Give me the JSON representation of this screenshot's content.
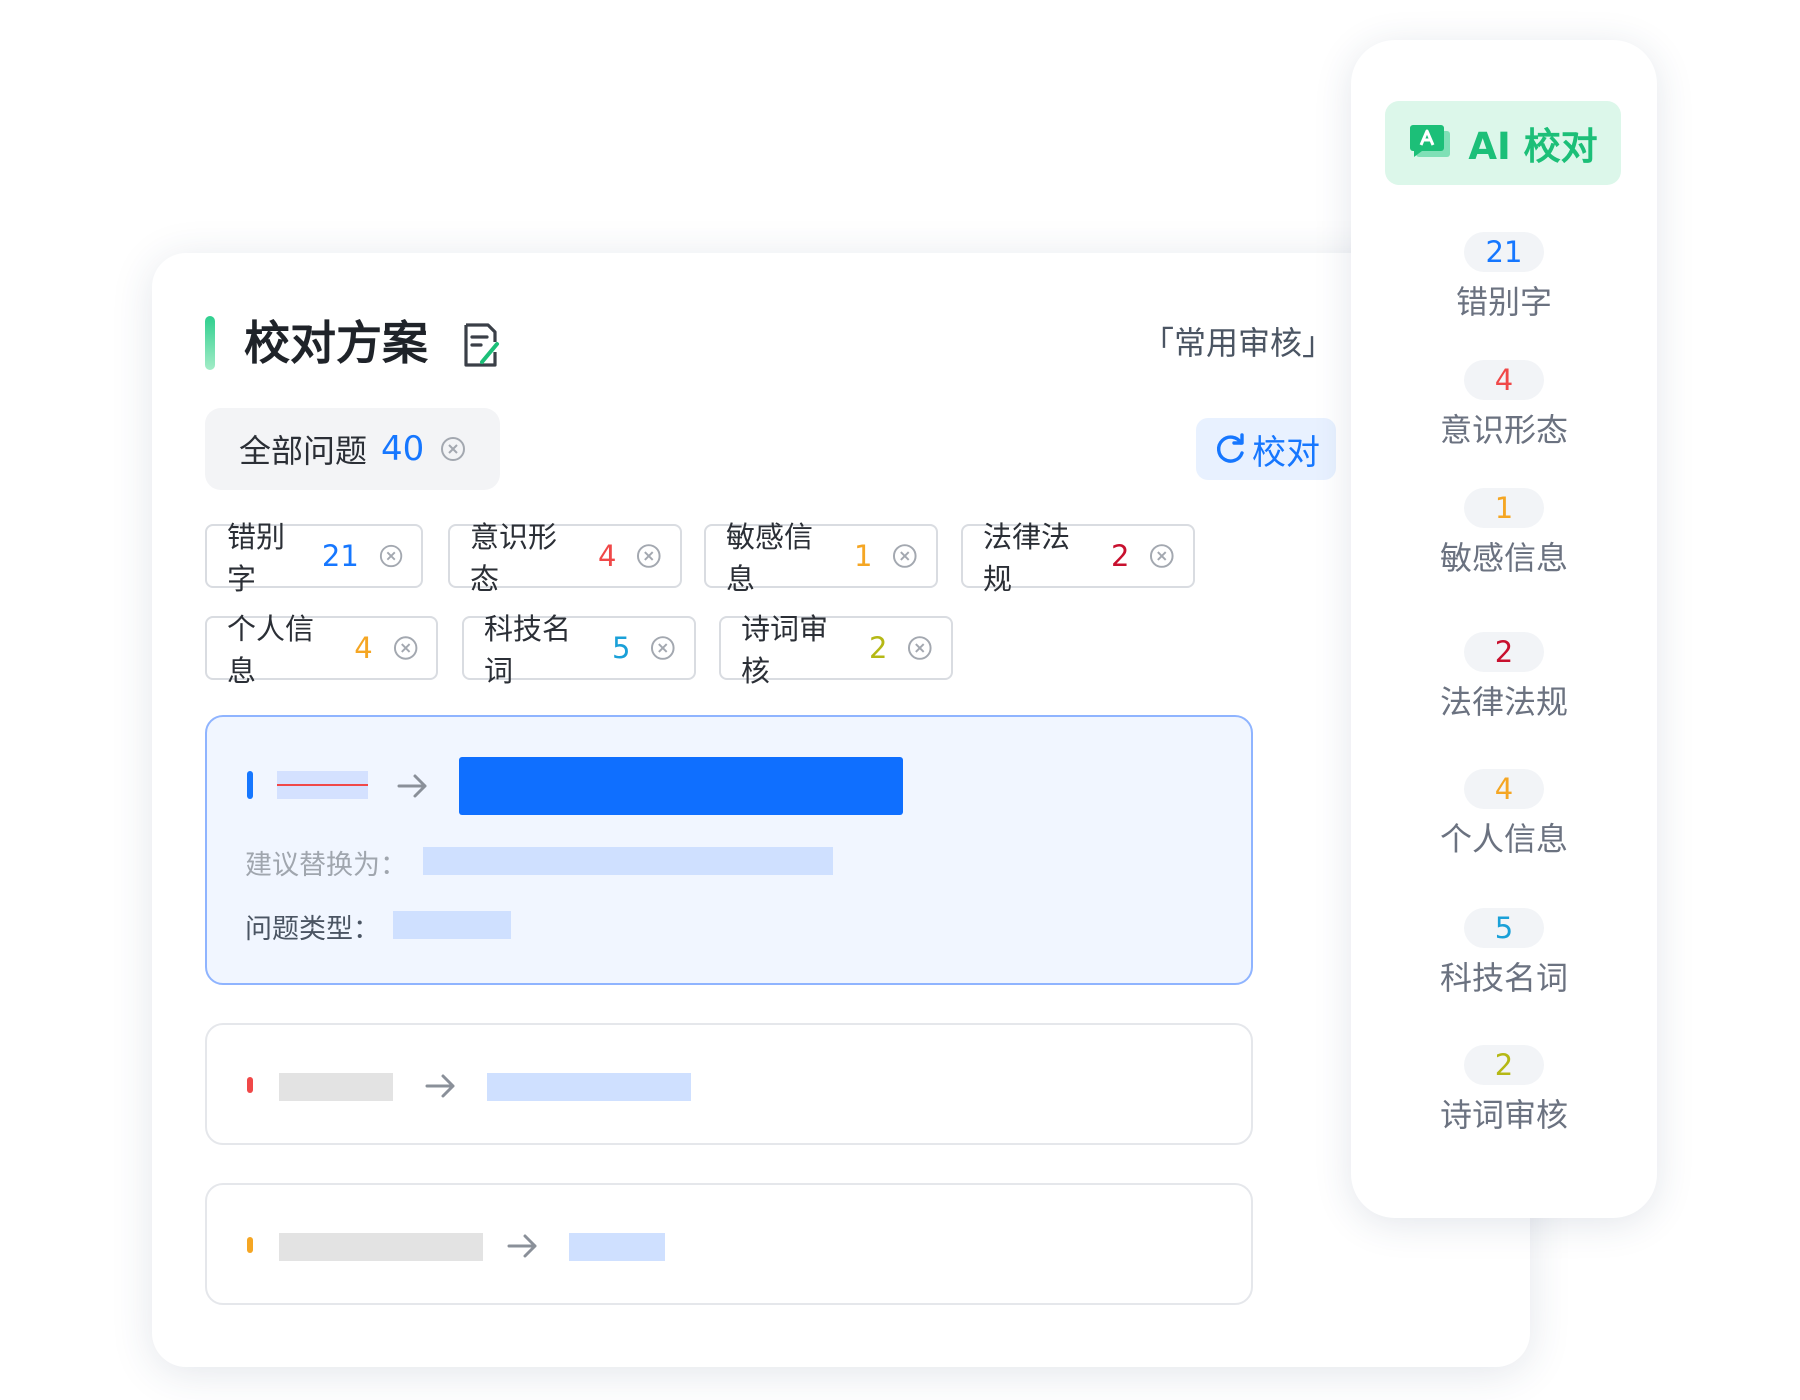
{
  "panel": {
    "title": "校对方案",
    "plan_name": "「常用审核」",
    "all_issues": {
      "label": "全部问题",
      "count": "40"
    },
    "proofread_button": "校对",
    "tags": [
      {
        "label": "错别字",
        "count": "21",
        "color": "#1677ff"
      },
      {
        "label": "意识形态",
        "count": "4",
        "color": "#f04848"
      },
      {
        "label": "敏感信息",
        "count": "1",
        "color": "#f5a623"
      },
      {
        "label": "法律法规",
        "count": "2",
        "color": "#c8102e"
      },
      {
        "label": "个人信息",
        "count": "4",
        "color": "#f5a623"
      },
      {
        "label": "科技名词",
        "count": "5",
        "color": "#1aa0d8"
      },
      {
        "label": "诗词审核",
        "count": "2",
        "color": "#b5b815"
      }
    ],
    "issue_card": {
      "suggest_label": "建议替换为：",
      "type_label": "问题类型："
    },
    "issue_markers": [
      "#1677ff",
      "#f04848",
      "#f5a623"
    ]
  },
  "sidebar": {
    "ai_button": "AI 校对",
    "stats": [
      {
        "count": "21",
        "label": "错别字",
        "color": "#1677ff"
      },
      {
        "count": "4",
        "label": "意识形态",
        "color": "#f04848"
      },
      {
        "count": "1",
        "label": "敏感信息",
        "color": "#f5a623"
      },
      {
        "count": "2",
        "label": "法律法规",
        "color": "#c8102e"
      },
      {
        "count": "4",
        "label": "个人信息",
        "color": "#f5a623"
      },
      {
        "count": "5",
        "label": "科技名词",
        "color": "#1aa0d8"
      },
      {
        "count": "2",
        "label": "诗词审核",
        "color": "#b5b815"
      }
    ]
  },
  "colors": {
    "brand_green": "#1cbf78",
    "primary_blue": "#1677ff",
    "placeholder_blue": "#cfe0ff",
    "placeholder_gray": "#e3e3e3"
  }
}
